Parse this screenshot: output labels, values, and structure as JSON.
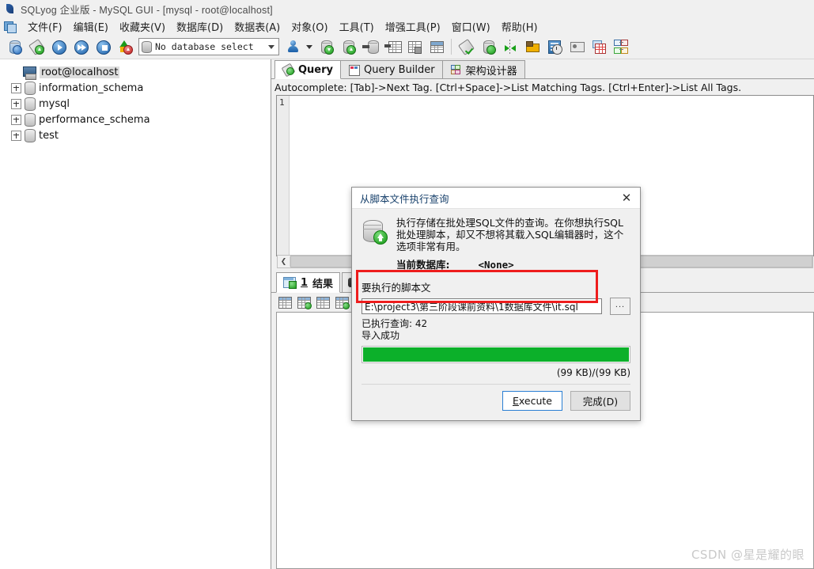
{
  "window": {
    "title": "SQLyog 企业版 - MySQL GUI - [mysql - root@localhost]",
    "app_icon": "sqlyog-logo-icon"
  },
  "menubar": {
    "app_icon": "window-restore-icon",
    "items": [
      {
        "label": "文件(F)",
        "name": "menu-file"
      },
      {
        "label": "编辑(E)",
        "name": "menu-edit"
      },
      {
        "label": "收藏夹(V)",
        "name": "menu-favorites"
      },
      {
        "label": "数据库(D)",
        "name": "menu-database"
      },
      {
        "label": "数据表(A)",
        "name": "menu-table"
      },
      {
        "label": "对象(O)",
        "name": "menu-objects"
      },
      {
        "label": "工具(T)",
        "name": "menu-tools"
      },
      {
        "label": "增强工具(P)",
        "name": "menu-powertools"
      },
      {
        "label": "窗口(W)",
        "name": "menu-window"
      },
      {
        "label": "帮助(H)",
        "name": "menu-help"
      }
    ]
  },
  "toolbar": {
    "db_selector_value": "No database select",
    "buttons": [
      {
        "name": "new-connection-button",
        "icon": "database-connect-icon"
      },
      {
        "name": "new-query-tab-button",
        "icon": "query-new-icon"
      },
      {
        "name": "execute-query-button",
        "icon": "play-icon"
      },
      {
        "name": "execute-all-queries-button",
        "icon": "play-all-icon"
      },
      {
        "name": "execute-query-and-save-button",
        "icon": "play-save-icon"
      },
      {
        "name": "refresh-object-browser-button",
        "icon": "refresh-objects-icon"
      }
    ],
    "buttons2": [
      {
        "name": "user-manager-button",
        "icon": "user-icon"
      },
      {
        "name": "user-manager-dropdown",
        "icon": "chevron-down-icon"
      },
      {
        "name": "backup-database-button",
        "icon": "database-export-icon"
      },
      {
        "name": "restore-database-button",
        "icon": "database-import-icon"
      },
      {
        "name": "execute-sql-script-button",
        "icon": "database-run-script-icon"
      },
      {
        "name": "export-table-data-button",
        "icon": "table-export-icon"
      },
      {
        "name": "export-as-csv-button",
        "icon": "table-save-icon"
      },
      {
        "name": "import-external-data-button",
        "icon": "table-import-icon"
      }
    ],
    "buttons3": [
      {
        "name": "copy-database-button",
        "icon": "paint-check-icon"
      },
      {
        "name": "sync-database-button",
        "icon": "database-sync-icon"
      },
      {
        "name": "schema-sync-button",
        "icon": "merge-arrows-icon"
      },
      {
        "name": "migrate-data-button",
        "icon": "data-transfer-icon"
      },
      {
        "name": "scheduled-backup-button",
        "icon": "schedule-clock-icon"
      },
      {
        "name": "notification-services-button",
        "icon": "notification-icon"
      },
      {
        "name": "sql-formatter-button",
        "icon": "format-grid-icon"
      },
      {
        "name": "schema-designer-button",
        "icon": "schema-diagram-icon"
      }
    ]
  },
  "sidebar": {
    "root": {
      "label": "root@localhost",
      "icon": "server-icon",
      "selected": true
    },
    "databases": [
      {
        "label": "information_schema",
        "icon": "database-icon"
      },
      {
        "label": "mysql",
        "icon": "database-icon"
      },
      {
        "label": "performance_schema",
        "icon": "database-icon"
      },
      {
        "label": "test",
        "icon": "database-icon"
      }
    ]
  },
  "editor": {
    "tabs": [
      {
        "label": "Query",
        "icon": "query-icon",
        "active": true
      },
      {
        "label": "Query Builder",
        "icon": "query-builder-icon",
        "active": false
      },
      {
        "label": "架构设计器",
        "icon": "schema-designer-icon",
        "active": false
      }
    ],
    "hint": "Autocomplete: [Tab]->Next Tag. [Ctrl+Space]->List Matching Tags. [Ctrl+Enter]->List All Tags.",
    "line_number": "1",
    "content": ""
  },
  "results": {
    "tab_number": "1",
    "tab_label": "结果",
    "tab_icon": "result-grid-icon",
    "search_tab_icon": "binoculars-icon",
    "toolbar_buttons": [
      {
        "name": "grid-view-button",
        "icon": "grid-icon"
      },
      {
        "name": "insert-row-button",
        "icon": "grid-insert-icon"
      },
      {
        "name": "duplicate-row-button",
        "icon": "grid-duplicate-icon"
      },
      {
        "name": "refresh-grid-button",
        "icon": "grid-refresh-icon"
      }
    ]
  },
  "dialog": {
    "title": "从脚本文件执行查询",
    "close_icon": "close-icon",
    "big_icon": "database-upload-icon",
    "description": "执行存储在批处理SQL文件的查询。在你想执行SQL批处理脚本，却又不想将其载入SQL编辑器时，这个选项非常有用。",
    "current_db_label": "当前数据库:",
    "current_db_value": "<None>",
    "field_label": "要执行的脚本文",
    "file_path": "E:\\project3\\第三阶段课前资料\\1数据库文件\\it.sql",
    "browse_button": "...",
    "status_executed": "已执行查询: 42",
    "status_result": "导入成功",
    "progress_percent": 100,
    "progress_color": "#0cb02a",
    "size_text": "(99 KB)/(99 KB)",
    "execute_button": "Execute",
    "execute_accesskey": "E",
    "done_button": "完成(D)",
    "highlight_color": "#ee1d1d"
  },
  "watermark": "CSDN @星是耀的眼"
}
